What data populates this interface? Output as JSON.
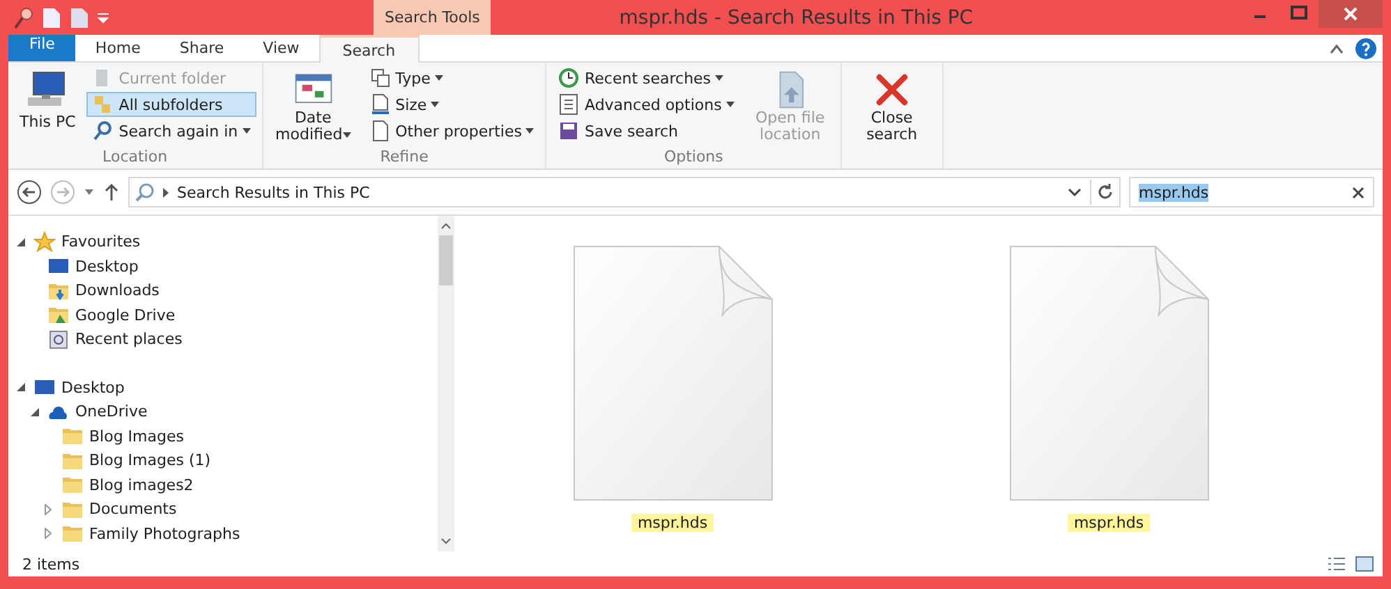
{
  "window": {
    "title": "mspr.hds - Search Results in This PC"
  },
  "context_tab": {
    "label": "Search Tools"
  },
  "ribbon_tabs": [
    {
      "label": "File",
      "kind": "file",
      "selected": false
    },
    {
      "label": "Home",
      "kind": "tab",
      "selected": false
    },
    {
      "label": "Share",
      "kind": "tab",
      "selected": false
    },
    {
      "label": "View",
      "kind": "tab",
      "selected": false
    },
    {
      "label": "Search",
      "kind": "tab",
      "selected": true
    }
  ],
  "ribbon_groups": [
    {
      "label": "Location",
      "buttons": [
        {
          "label": "This PC",
          "kind": "large",
          "disabled": false,
          "on": false,
          "dropdown": false
        },
        {
          "label": "Current folder",
          "kind": "small",
          "disabled": true,
          "on": false,
          "dropdown": false
        },
        {
          "label": "All subfolders",
          "kind": "small",
          "disabled": false,
          "on": true,
          "dropdown": false
        },
        {
          "label": "Search again in",
          "kind": "small",
          "disabled": false,
          "on": false,
          "dropdown": true
        }
      ]
    },
    {
      "label": "Refine",
      "buttons": [
        {
          "label": "Date modified",
          "kind": "large",
          "disabled": false,
          "on": false,
          "dropdown": true
        },
        {
          "label": "Type",
          "kind": "small",
          "disabled": false,
          "on": false,
          "dropdown": true
        },
        {
          "label": "Size",
          "kind": "small",
          "disabled": false,
          "on": false,
          "dropdown": true
        },
        {
          "label": "Other properties",
          "kind": "small",
          "disabled": false,
          "on": false,
          "dropdown": true
        }
      ]
    },
    {
      "label": "Options",
      "buttons": [
        {
          "label": "Recent searches",
          "kind": "small",
          "disabled": false,
          "on": false,
          "dropdown": true
        },
        {
          "label": "Advanced options",
          "kind": "small",
          "disabled": false,
          "on": false,
          "dropdown": true
        },
        {
          "label": "Save search",
          "kind": "small",
          "disabled": false,
          "on": false,
          "dropdown": false
        },
        {
          "label": "Open file location",
          "kind": "large",
          "disabled": true,
          "on": false,
          "dropdown": false
        }
      ]
    },
    {
      "buttons": [
        {
          "label": "Close search",
          "kind": "large",
          "disabled": false,
          "on": false,
          "dropdown": false
        }
      ]
    }
  ],
  "address": {
    "path": "Search Results in This PC"
  },
  "search": {
    "value": "mspr.hds"
  },
  "navigation": [
    {
      "label": "Favourites",
      "expanded": true,
      "children": [
        {
          "label": "Desktop"
        },
        {
          "label": "Downloads"
        },
        {
          "label": "Google Drive"
        },
        {
          "label": "Recent places"
        }
      ]
    },
    {
      "label": "Desktop",
      "expanded": true,
      "children": [
        {
          "label": "OneDrive",
          "expanded": true,
          "children": [
            {
              "label": "Blog Images"
            },
            {
              "label": "Blog Images (1)"
            },
            {
              "label": "Blog images2"
            },
            {
              "label": "Documents",
              "expanded": false
            },
            {
              "label": "Family Photographs",
              "expanded": false
            }
          ]
        }
      ]
    }
  ],
  "files": [
    {
      "name": "mspr.hds",
      "highlighted": true
    },
    {
      "name": "mspr.hds",
      "highlighted": true
    }
  ],
  "status_bar": {
    "count": "2 items"
  }
}
